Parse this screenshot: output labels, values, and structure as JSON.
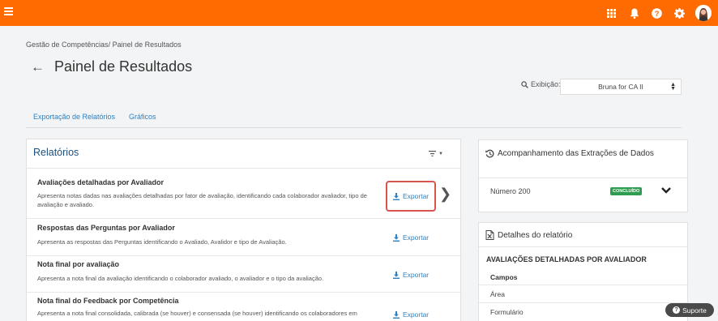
{
  "colors": {
    "brand": "#ff6b00",
    "link": "#2f80c0",
    "success": "#2e9d4f",
    "highlight": "#d9534f"
  },
  "topbar": {
    "icons": [
      "menu-icon",
      "apps-grid-icon",
      "bell-icon",
      "help-icon",
      "gear-icon",
      "user-avatar"
    ]
  },
  "breadcrumb": {
    "parent": "Gestão de Competências",
    "separator": "/",
    "current": "Painel de Resultados"
  },
  "page": {
    "title": "Painel de Resultados"
  },
  "exibicao": {
    "label": "Exibição:",
    "value": "Bruna for CA II"
  },
  "tabs": [
    {
      "label": "Exportação de Relatórios"
    },
    {
      "label": "Gráficos"
    }
  ],
  "relatorios": {
    "title": "Relatórios",
    "export_label": "Exportar",
    "items": [
      {
        "title": "Avaliações detalhadas por Avaliador",
        "description": "Apresenta notas dadas nas avaliações detalhadas por fator de avaliação, identificando cada colaborador avaliador, tipo de avaliação e avaliado."
      },
      {
        "title": "Respostas das Perguntas por Avaliador",
        "description": "Apresenta as respostas das Perguntas identificando o Avaliado, Avalidor e tipo de Avaliação."
      },
      {
        "title": "Nota final por avaliação",
        "description": "Apresenta a nota final da avaliação identificando o colaborador avaliado, o avaliador e o tipo da avaliação."
      },
      {
        "title": "Nota final do Feedback por Competência",
        "description": "Apresenta a nota final consolidada, calibrada (se houver) e consensada (se houver) identificando os colaboradores em"
      }
    ]
  },
  "acompanhamento": {
    "title": "Acompanhamento das Extrações de Dados",
    "item_label": "Número 200",
    "status": "CONCLUÍDO"
  },
  "detalhes": {
    "title": "Detalhes do relatório",
    "report_name": "AVALIAÇÕES DETALHADAS POR AVALIADOR",
    "campos_label": "Campos",
    "fields": [
      "Área",
      "Formulário"
    ]
  },
  "suporte": {
    "label": "Suporte"
  }
}
